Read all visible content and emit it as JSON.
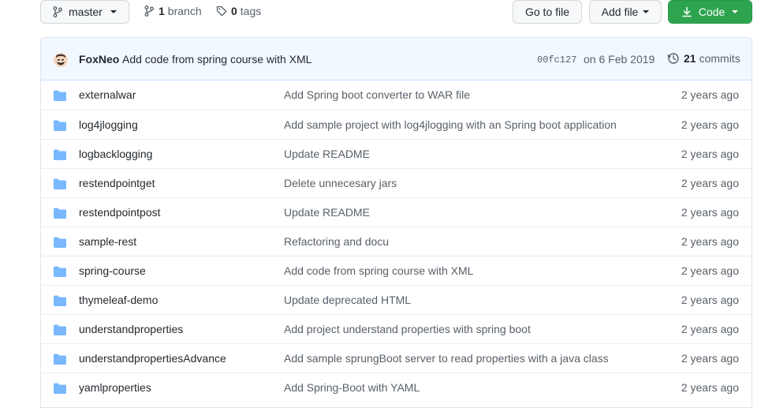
{
  "toolbar": {
    "branch_name": "master",
    "branch_count": "1",
    "branch_label": "branch",
    "tag_count": "0",
    "tag_label": "tags",
    "go_to_file": "Go to file",
    "add_file": "Add file",
    "code": "Code"
  },
  "latest_commit": {
    "author": "FoxNeo",
    "message": "Add code from spring course with XML",
    "sha": "00fc127",
    "date": "on 6 Feb 2019",
    "commit_count": "21",
    "commit_label": "commits"
  },
  "files": [
    {
      "name": "externalwar",
      "message": "Add Spring boot converter to WAR file",
      "age": "2 years ago"
    },
    {
      "name": "log4jlogging",
      "message": "Add sample project with log4jlogging with an Spring boot application",
      "age": "2 years ago"
    },
    {
      "name": "logbacklogging",
      "message": "Update README",
      "age": "2 years ago"
    },
    {
      "name": "restendpointget",
      "message": "Delete unnecesary jars",
      "age": "2 years ago"
    },
    {
      "name": "restendpointpost",
      "message": "Update README",
      "age": "2 years ago"
    },
    {
      "name": "sample-rest",
      "message": "Refactoring and docu",
      "age": "2 years ago"
    },
    {
      "name": "spring-course",
      "message": "Add code from spring course with XML",
      "age": "2 years ago"
    },
    {
      "name": "thymeleaf-demo",
      "message": "Update deprecated HTML",
      "age": "2 years ago"
    },
    {
      "name": "understandproperties",
      "message": "Add project understand properties with spring boot",
      "age": "2 years ago"
    },
    {
      "name": "understandpropertiesAdvance",
      "message": "Add sample sprungBoot server to read properties with a java class",
      "age": "2 years ago"
    },
    {
      "name": "yamlproperties",
      "message": "Add Spring-Boot with YAML",
      "age": "2 years ago"
    }
  ],
  "colors": {
    "folder": "#79b8ff",
    "code_button": "#2ea44f",
    "commit_header_bg": "#f1f8ff"
  }
}
